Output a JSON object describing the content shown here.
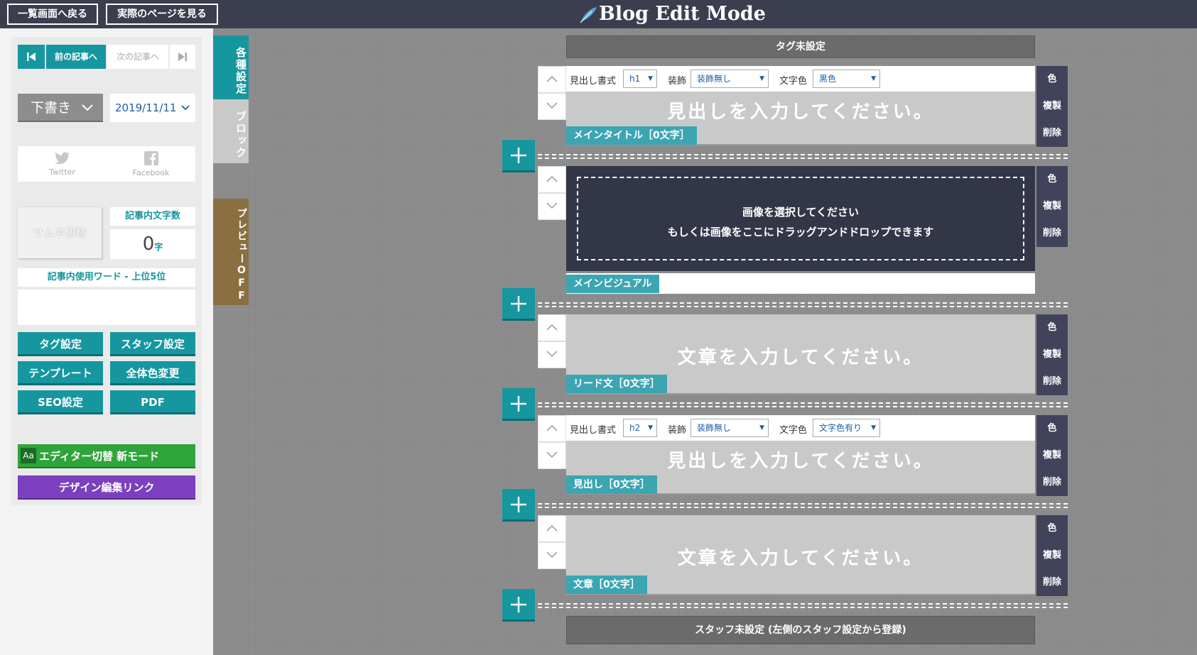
{
  "header": {
    "back_list": "一覧画面へ戻る",
    "view_page": "実際のページを見る",
    "logo": "Blog Edit Mode"
  },
  "nav": {
    "prev": "前の記事へ",
    "next": "次の記事へ"
  },
  "status": {
    "draft": "下書き",
    "date": "2019/11/11"
  },
  "social": {
    "twitter": "Twitter",
    "facebook": "Facebook"
  },
  "stats": {
    "thumbnail": "サムネ切替",
    "char_count_label": "記事内文字数",
    "char_count": "0",
    "char_unit": "字",
    "words_label": "記事内使用ワード - 上位5位"
  },
  "buttons": {
    "tag": "タグ設定",
    "staff": "スタッフ設定",
    "template": "テンプレート",
    "color": "全体色変更",
    "seo": "SEO設定",
    "pdf": "PDF",
    "editor_icon": "Aa",
    "editor_switch": "エディター切替 新モード",
    "design_link": "デザイン編集リンク"
  },
  "sidetabs": {
    "settings": "各種設定",
    "block": "ブロック",
    "preview": "プレビューOFF"
  },
  "editor": {
    "tag_band": "タグ未設定",
    "staff_band": "スタッフ未設定 (左側のスタッフ設定から登録)",
    "heading_format": "見出し書式",
    "decoration": "装飾",
    "text_color": "文字色",
    "block1": {
      "format": "h1",
      "decor": "装飾無し",
      "color": "黒色",
      "placeholder": "見出しを入力してください。",
      "label": "メインタイトル［0文字］"
    },
    "block2": {
      "line1": "画像を選択してください",
      "line2": "もしくは画像をここにドラッグアンドドロップできます",
      "label": "メインビジュアル"
    },
    "block3": {
      "placeholder": "文章を入力してください。",
      "label": "リード文［0文字］"
    },
    "block4": {
      "format": "h2",
      "decor": "装飾無し",
      "color": "文字色有り",
      "placeholder": "見出しを入力してください。",
      "label": "見出し［0文字］"
    },
    "block5": {
      "placeholder": "文章を入力してください。",
      "label": "文章［0文字］"
    },
    "actions": {
      "color": "色",
      "copy": "複製",
      "delete": "削除"
    }
  },
  "colors": {
    "teal": "#16969f",
    "header": "#3b3e4e",
    "green": "#2fa43a",
    "purple": "#7b3fbf",
    "olive": "#8a7040"
  }
}
